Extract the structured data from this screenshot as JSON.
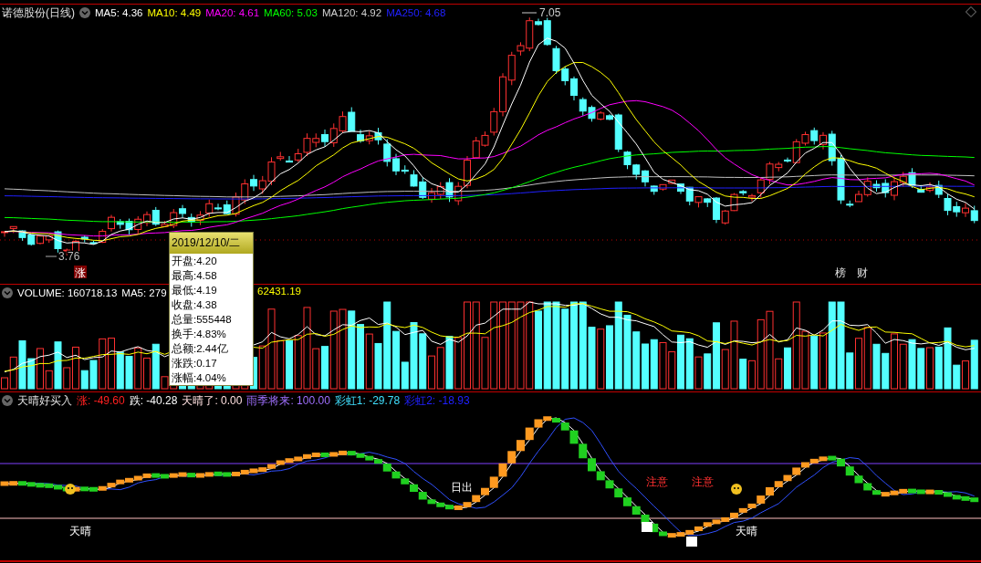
{
  "price_panel": {
    "title": "诺德股份(日线)",
    "indicators": [
      {
        "label": "MA5: 4.36",
        "color": "#ffffff"
      },
      {
        "label": "MA10: 4.49",
        "color": "#ffff00"
      },
      {
        "label": "MA20: 4.61",
        "color": "#ff00ff"
      },
      {
        "label": "MA60: 5.03",
        "color": "#00ff00"
      },
      {
        "label": "MA120: 4.92",
        "color": "#d0d0d0"
      },
      {
        "label": "MA250: 4.68",
        "color": "#2020ff"
      }
    ],
    "high_label": "7.05",
    "low_label": "3.76",
    "markers": [
      {
        "text": "涨",
        "kind": "boxed"
      },
      {
        "text": "榜",
        "kind": "plain"
      },
      {
        "text": "财",
        "kind": "plain"
      }
    ]
  },
  "tooltip": {
    "date": "2019/12/10/二",
    "rows": [
      "开盘:4.20",
      "最高:4.58",
      "最低:4.19",
      "收盘:4.38",
      "总量:555448",
      "换手:4.83%",
      "总额:2.44亿",
      "涨跌:0.17",
      "涨幅:4.04%"
    ]
  },
  "volume_panel": {
    "indicators": [
      {
        "label": "VOLUME: 160718.13",
        "color": "#ffffff"
      },
      {
        "label": "MA5: 279",
        "color": "#ffffff"
      },
      {
        "label": "62431.19",
        "color": "#ffff00"
      }
    ]
  },
  "signal_panel": {
    "title": "天晴好买入",
    "indicators": [
      {
        "label": "涨: -49.60",
        "color": "#ff2020"
      },
      {
        "label": "跌: -40.28",
        "color": "#ffffff"
      },
      {
        "label": "天晴了: 0.00",
        "color": "#ffe0e0"
      },
      {
        "label": "雨季将来: 100.00",
        "color": "#a070ff"
      },
      {
        "label": "彩虹1: -29.78",
        "color": "#40e0ff"
      },
      {
        "label": "彩虹2: -18.93",
        "color": "#2020ff"
      }
    ],
    "labels": [
      {
        "text": "天晴",
        "kind": "sun"
      },
      {
        "text": "日出",
        "kind": "plain"
      },
      {
        "text": "注意",
        "kind": "warn"
      },
      {
        "text": "注意",
        "kind": "warn"
      },
      {
        "text": "天晴",
        "kind": "sun"
      }
    ]
  }
}
